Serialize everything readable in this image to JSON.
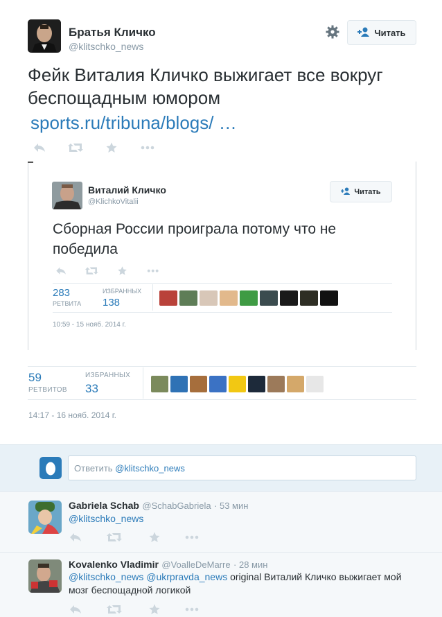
{
  "header": {
    "name": "Братья Кличко",
    "handle": "@klitschko_news",
    "follow_label": "Читать"
  },
  "tweet": {
    "text": "Фейк Виталия Кличко выжигает все вокруг беспощадным юмором",
    "link": "sports.ru/tribuna/blogs/ …",
    "stats": {
      "retweets_count": "59",
      "retweets_label": "РЕТВИТОВ",
      "favorites_label": "ИЗБРАННЫХ",
      "favorites_count": "33"
    },
    "timestamp": "14:17 - 16 нояб. 2014 г."
  },
  "embed": {
    "name": "Виталий Кличко",
    "handle": "@KlichkoVitalii",
    "follow_label": "Читать",
    "text": "Сборная России проиграла потому что не победила",
    "retweets_count": "283",
    "retweets_label": "РЕТВИТА",
    "favorites_label": "ИЗБРАННЫХ",
    "favorites_count": "138",
    "timestamp": "10:59 - 15 нояб. 2014 г."
  },
  "reply_box": {
    "placeholder_prefix": "Ответить",
    "mention": "@klitschko_news"
  },
  "replies": [
    {
      "name": "Gabriela Schab",
      "handle": "@SchabGabriela",
      "time": "· 53 мин",
      "mention": "@klitschko_news",
      "text": ""
    },
    {
      "name": "Kovalenko Vladimir",
      "handle": "@VoalleDeMarre",
      "time": "· 28 мин",
      "mention1": "@klitschko_news",
      "mention2": "@ukrpravda_news",
      "text": "original Виталий Кличко выжигает мой мозг беспощадной логикой"
    }
  ],
  "colors": {
    "link": "#2b7bb9",
    "muted": "#8899a6",
    "action": "#ccd6dd"
  }
}
